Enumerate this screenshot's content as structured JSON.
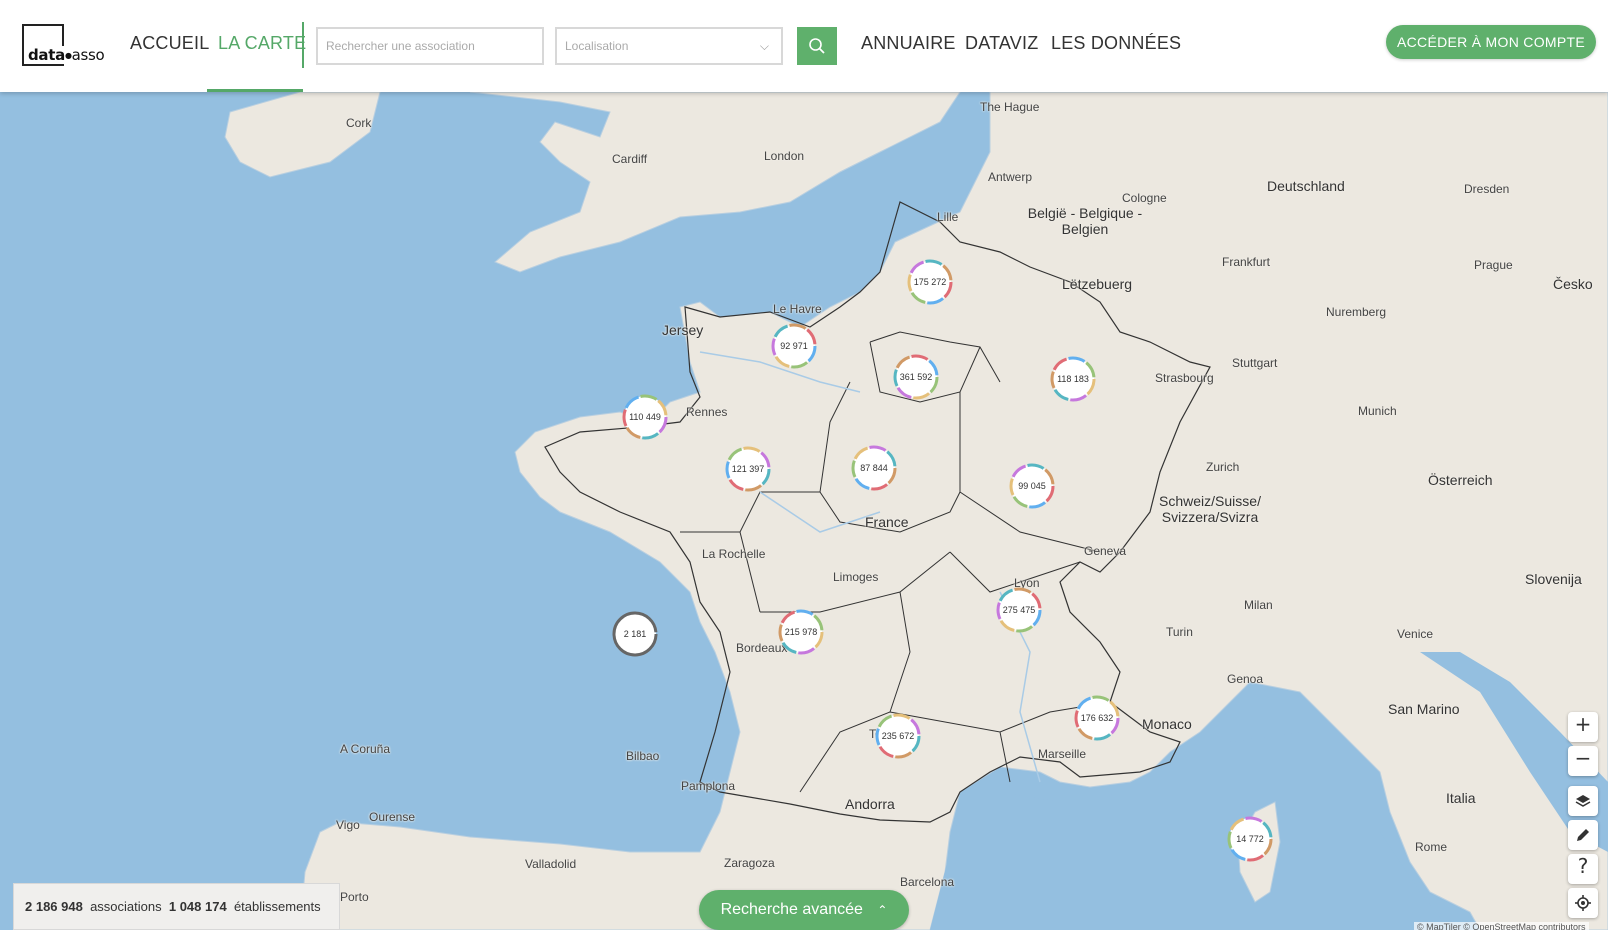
{
  "logo": {
    "bold": "data",
    "thin": "asso"
  },
  "nav": {
    "accueil": "ACCUEIL",
    "la_carte": "LA CARTE",
    "annuaire": "ANNUAIRE",
    "dataviz": "DATAVIZ",
    "donnees": "LES DONNÉES"
  },
  "search": {
    "placeholder": "Rechercher une association"
  },
  "location": {
    "placeholder": "Localisation"
  },
  "account_button": "ACCÉDER À MON COMPTE",
  "colors": {
    "accent": "#5fb06c",
    "water": "#94bfe0",
    "land": "#ece8e0"
  },
  "places": {
    "cork": "Cork",
    "cardiff": "Cardiff",
    "london": "London",
    "the_hague": "The Hague",
    "antwerp": "Antwerp",
    "cologne": "Cologne",
    "deutschland": "Deutschland",
    "dresden": "Dresden",
    "belgique": "België - Belgique - Belgien",
    "lille": "Lille",
    "frankfurt": "Frankfurt",
    "prague": "Prague",
    "cesko": "Česko",
    "letzebuerg": "Lëtzebuerg",
    "nuremberg": "Nuremberg",
    "le_havre": "Le Havre",
    "jersey": "Jersey",
    "stuttgart": "Stuttgart",
    "strasbourg": "Strasbourg",
    "munich": "Munich",
    "rennes": "Rennes",
    "zurich": "Zurich",
    "osterreich": "Österreich",
    "france": "France",
    "suisse": "Schweiz/Suisse/ Svizzera/Svizra",
    "la_rochelle": "La Rochelle",
    "geneva": "Geneva",
    "limoges": "Limoges",
    "lyon": "Lyon",
    "milan": "Milan",
    "venice": "Venice",
    "slovenija": "Slovenija",
    "turin": "Turin",
    "bordeaux": "Bordeaux",
    "genoa": "Genoa",
    "san_marino": "San Marino",
    "monaco": "Monaco",
    "toulouse": "Toulouse",
    "marseille": "Marseille",
    "a_coruna": "A Coruña",
    "bilbao": "Bilbao",
    "pamplona": "Pamplona",
    "andorra": "Andorra",
    "italia": "Italia",
    "vigo": "Vigo",
    "ourense": "Ourense",
    "rome": "Rome",
    "valladolid": "Valladolid",
    "zaragoza": "Zaragoza",
    "porto": "Porto",
    "barcelona": "Barcelona"
  },
  "clusters": [
    {
      "label": "175 272"
    },
    {
      "label": "92 971"
    },
    {
      "label": "361 592"
    },
    {
      "label": "118 183"
    },
    {
      "label": "110 449"
    },
    {
      "label": "121 397"
    },
    {
      "label": "87 844"
    },
    {
      "label": "99 045"
    },
    {
      "label": "275 475"
    },
    {
      "label": "2 181"
    },
    {
      "label": "215 978"
    },
    {
      "label": "176 632"
    },
    {
      "label": "235 672"
    },
    {
      "label": "14 772"
    }
  ],
  "stats": {
    "associations_count": "2 186 948",
    "associations_label": "associations",
    "etablissements_count": "1 048 174",
    "etablissements_label": "établissements"
  },
  "advanced_search": "Recherche avancée",
  "attribution": "© MapTiler © OpenStreetMap contributors",
  "controls": {
    "zoom_in": "+",
    "zoom_out": "−",
    "help": "?"
  }
}
